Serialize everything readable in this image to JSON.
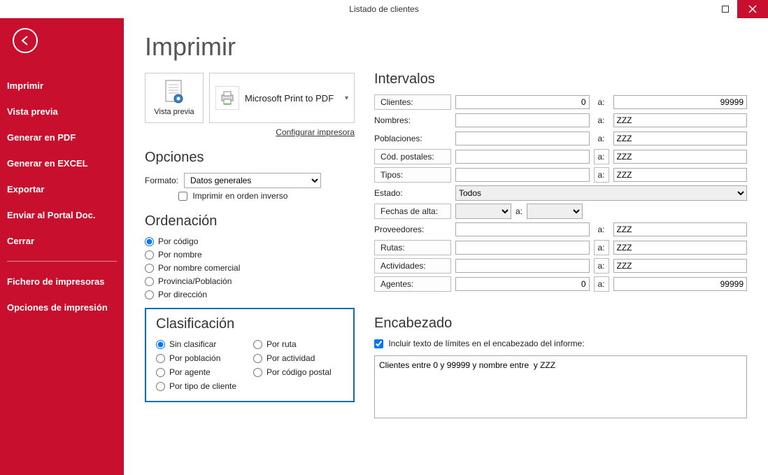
{
  "window": {
    "title": "Listado de clientes"
  },
  "sidebar": {
    "items": [
      "Imprimir",
      "Vista previa",
      "Generar en PDF",
      "Generar en EXCEL",
      "Exportar",
      "Enviar al Portal Doc.",
      "Cerrar"
    ],
    "items2": [
      "Fichero de impresoras",
      "Opciones de impresión"
    ]
  },
  "page_title": "Imprimir",
  "preview_tile": "Vista previa",
  "printer_name": "Microsoft Print to PDF",
  "config_printer": "Configurar impresora",
  "opciones": {
    "heading": "Opciones",
    "formato_label": "Formato:",
    "formato_value": "Datos generales",
    "reverse_label": "Imprimir en orden inverso"
  },
  "orden": {
    "heading": "Ordenación",
    "options": [
      "Por código",
      "Por nombre",
      "Por nombre comercial",
      "Provincia/Población",
      "Por dirección"
    ],
    "selected": 0
  },
  "clasif": {
    "heading": "Clasificación",
    "options": [
      "Sin clasificar",
      "Por población",
      "Por agente",
      "Por tipo de cliente",
      "Por ruta",
      "Por actividad",
      "Por código postal"
    ],
    "selected": 0
  },
  "intervalos": {
    "heading": "Intervalos",
    "a": "a:",
    "rows": {
      "clientes": {
        "label": "Clientes:",
        "from": "0",
        "to": "99999",
        "btn": true,
        "num": true,
        "to_btn": false,
        "narrow": true
      },
      "nombres": {
        "label": "Nombres:",
        "from": "",
        "to": "ZZZ",
        "btn": false,
        "num": false
      },
      "poblaciones": {
        "label": "Poblaciones:",
        "from": "",
        "to": "ZZZ",
        "btn": false,
        "num": false
      },
      "codpost": {
        "label": "Cód. postales:",
        "from": "",
        "to": "ZZZ",
        "btn": true,
        "to_btn": true,
        "narrow": true
      },
      "tipos": {
        "label": "Tipos:",
        "from": "",
        "to": "ZZZ",
        "btn": true,
        "to_btn": true,
        "tiny": true
      },
      "estado": {
        "label": "Estado:",
        "value": "Todos"
      },
      "fechas": {
        "label": "Fechas de alta:"
      },
      "proveedores": {
        "label": "Proveedores:",
        "from": "",
        "to": "ZZZ",
        "btn": false
      },
      "rutas": {
        "label": "Rutas:",
        "from": "",
        "to": "ZZZ",
        "btn": true,
        "to_btn": true,
        "tiny": true
      },
      "actividades": {
        "label": "Actividades:",
        "from": "",
        "to": "ZZZ",
        "btn": true,
        "to_btn": true,
        "tiny": true
      },
      "agentes": {
        "label": "Agentes:",
        "from": "0",
        "to": "99999",
        "btn": true,
        "to_btn": true,
        "num": true,
        "tiny": true
      }
    }
  },
  "encabezado": {
    "heading": "Encabezado",
    "check_label": "Incluir texto de límites en el encabezado del informe:",
    "text": "Clientes entre 0 y 99999 y nombre entre  y ZZZ"
  }
}
